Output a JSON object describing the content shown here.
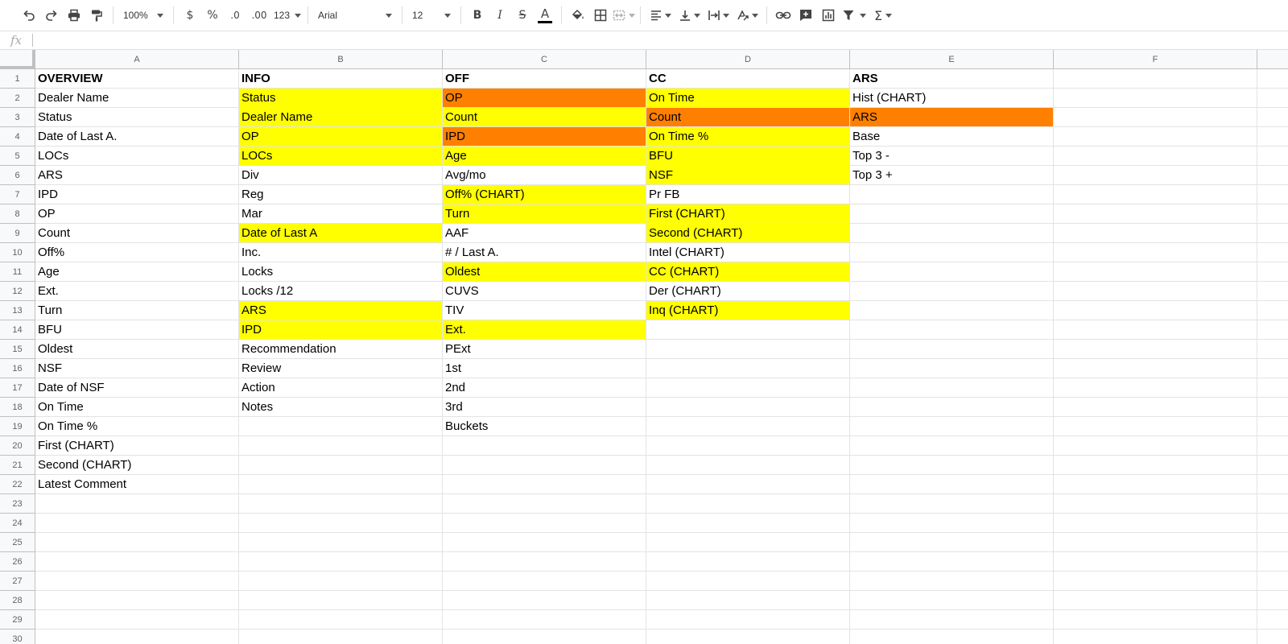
{
  "toolbar": {
    "zoom": "100%",
    "currency": "$",
    "percent": "%",
    "decrease_decimals": ".0",
    "increase_decimals": ".00",
    "number_format": "123",
    "font_family": "Arial",
    "font_size": "12",
    "bold": "B",
    "italic": "I",
    "strikethrough": "S",
    "text_color_glyph": "A",
    "sum_glyph": "Σ"
  },
  "formula_bar": {
    "fx_label": "fx",
    "value": ""
  },
  "colors": {
    "yellow": "#ffff00",
    "orange": "#ff8000",
    "white": "#ffffff"
  },
  "columns": [
    "A",
    "B",
    "C",
    "D",
    "E",
    "F"
  ],
  "row_count": 31,
  "grid": [
    [
      {
        "v": "OVERVIEW",
        "b": true
      },
      {
        "v": "INFO",
        "b": true
      },
      {
        "v": "OFF",
        "b": true
      },
      {
        "v": "CC",
        "b": true
      },
      {
        "v": "ARS",
        "b": true
      },
      {
        "v": ""
      }
    ],
    [
      {
        "v": "Dealer Name"
      },
      {
        "v": "Status",
        "c": "yellow"
      },
      {
        "v": "OP",
        "c": "orange"
      },
      {
        "v": "On Time",
        "c": "yellow"
      },
      {
        "v": "Hist (CHART)"
      },
      {
        "v": ""
      }
    ],
    [
      {
        "v": "Status"
      },
      {
        "v": "Dealer Name",
        "c": "yellow"
      },
      {
        "v": "Count",
        "c": "yellow"
      },
      {
        "v": "Count",
        "c": "orange"
      },
      {
        "v": "ARS",
        "c": "orange"
      },
      {
        "v": ""
      }
    ],
    [
      {
        "v": "Date of Last A."
      },
      {
        "v": "OP",
        "c": "yellow"
      },
      {
        "v": "IPD",
        "c": "orange"
      },
      {
        "v": "On Time %",
        "c": "yellow"
      },
      {
        "v": "Base"
      },
      {
        "v": ""
      }
    ],
    [
      {
        "v": "LOCs"
      },
      {
        "v": "LOCs",
        "c": "yellow"
      },
      {
        "v": "Age",
        "c": "yellow"
      },
      {
        "v": "BFU",
        "c": "yellow"
      },
      {
        "v": "Top 3 -"
      },
      {
        "v": ""
      }
    ],
    [
      {
        "v": "ARS"
      },
      {
        "v": "Div"
      },
      {
        "v": "Avg/mo"
      },
      {
        "v": "NSF",
        "c": "yellow"
      },
      {
        "v": "Top 3 +"
      },
      {
        "v": ""
      }
    ],
    [
      {
        "v": "IPD"
      },
      {
        "v": "Reg"
      },
      {
        "v": "Off% (CHART)",
        "c": "yellow"
      },
      {
        "v": "Pr FB"
      },
      {
        "v": ""
      },
      {
        "v": ""
      }
    ],
    [
      {
        "v": "OP"
      },
      {
        "v": "Mar"
      },
      {
        "v": "Turn",
        "c": "yellow"
      },
      {
        "v": "First (CHART)",
        "c": "yellow"
      },
      {
        "v": ""
      },
      {
        "v": ""
      }
    ],
    [
      {
        "v": "Count"
      },
      {
        "v": "Date of Last A",
        "c": "yellow"
      },
      {
        "v": "AAF"
      },
      {
        "v": "Second (CHART)",
        "c": "yellow"
      },
      {
        "v": ""
      },
      {
        "v": ""
      }
    ],
    [
      {
        "v": "Off%"
      },
      {
        "v": "Inc."
      },
      {
        "v": "# / Last A."
      },
      {
        "v": "Intel (CHART)"
      },
      {
        "v": ""
      },
      {
        "v": ""
      }
    ],
    [
      {
        "v": "Age"
      },
      {
        "v": "Locks"
      },
      {
        "v": "Oldest",
        "c": "yellow"
      },
      {
        "v": "CC (CHART)",
        "c": "yellow"
      },
      {
        "v": ""
      },
      {
        "v": ""
      }
    ],
    [
      {
        "v": "Ext."
      },
      {
        "v": "Locks /12"
      },
      {
        "v": "CUVS"
      },
      {
        "v": "Der (CHART)"
      },
      {
        "v": ""
      },
      {
        "v": ""
      }
    ],
    [
      {
        "v": "Turn"
      },
      {
        "v": "ARS",
        "c": "yellow"
      },
      {
        "v": "TIV"
      },
      {
        "v": "Inq (CHART)",
        "c": "yellow"
      },
      {
        "v": ""
      },
      {
        "v": ""
      }
    ],
    [
      {
        "v": "BFU"
      },
      {
        "v": "IPD",
        "c": "yellow"
      },
      {
        "v": "Ext.",
        "c": "yellow"
      },
      {
        "v": ""
      },
      {
        "v": ""
      },
      {
        "v": ""
      }
    ],
    [
      {
        "v": "Oldest"
      },
      {
        "v": "Recommendation"
      },
      {
        "v": "PExt"
      },
      {
        "v": ""
      },
      {
        "v": ""
      },
      {
        "v": ""
      }
    ],
    [
      {
        "v": "NSF"
      },
      {
        "v": "Review"
      },
      {
        "v": "1st"
      },
      {
        "v": ""
      },
      {
        "v": ""
      },
      {
        "v": ""
      }
    ],
    [
      {
        "v": "Date of NSF"
      },
      {
        "v": "Action"
      },
      {
        "v": "2nd"
      },
      {
        "v": ""
      },
      {
        "v": ""
      },
      {
        "v": ""
      }
    ],
    [
      {
        "v": "On Time"
      },
      {
        "v": "Notes"
      },
      {
        "v": "3rd"
      },
      {
        "v": ""
      },
      {
        "v": ""
      },
      {
        "v": ""
      }
    ],
    [
      {
        "v": "On Time %"
      },
      {
        "v": ""
      },
      {
        "v": "Buckets"
      },
      {
        "v": ""
      },
      {
        "v": ""
      },
      {
        "v": ""
      }
    ],
    [
      {
        "v": "First (CHART)"
      },
      {
        "v": ""
      },
      {
        "v": ""
      },
      {
        "v": ""
      },
      {
        "v": ""
      },
      {
        "v": ""
      }
    ],
    [
      {
        "v": "Second (CHART)"
      },
      {
        "v": ""
      },
      {
        "v": ""
      },
      {
        "v": ""
      },
      {
        "v": ""
      },
      {
        "v": ""
      }
    ],
    [
      {
        "v": "Latest Comment"
      },
      {
        "v": ""
      },
      {
        "v": ""
      },
      {
        "v": ""
      },
      {
        "v": ""
      },
      {
        "v": ""
      }
    ]
  ]
}
